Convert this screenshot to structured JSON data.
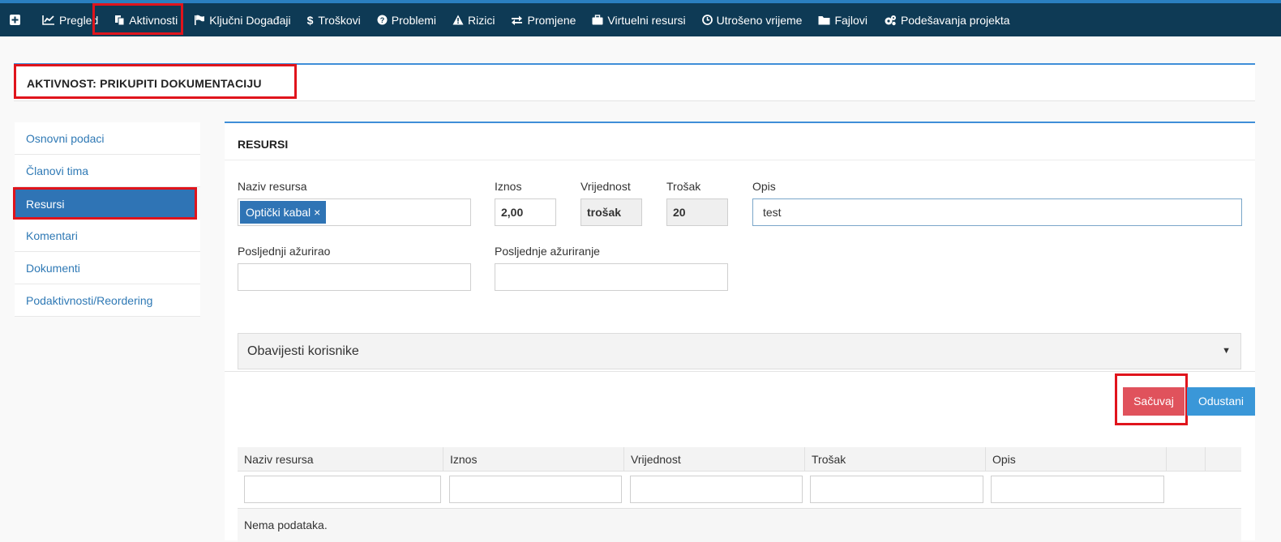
{
  "nav": {
    "items": [
      {
        "label": "Pregled",
        "icon": "chart-line-icon"
      },
      {
        "label": "Aktivnosti",
        "icon": "copy-icon"
      },
      {
        "label": "Ključni Događaji",
        "icon": "flag-icon"
      },
      {
        "label": "Troškovi",
        "icon": "dollar-icon"
      },
      {
        "label": "Problemi",
        "icon": "question-circle-icon"
      },
      {
        "label": "Rizici",
        "icon": "warning-icon"
      },
      {
        "label": "Promjene",
        "icon": "exchange-icon"
      },
      {
        "label": "Virtuelni resursi",
        "icon": "briefcase-icon"
      },
      {
        "label": "Utrošeno vrijeme",
        "icon": "clock-icon"
      },
      {
        "label": "Fajlovi",
        "icon": "folder-icon"
      },
      {
        "label": "Podešavanja projekta",
        "icon": "gears-icon"
      }
    ]
  },
  "page_title": "AKTIVNOST: PRIKUPITI DOKUMENTACIJU",
  "sidebar": {
    "items": [
      {
        "label": "Osnovni podaci"
      },
      {
        "label": "Članovi tima"
      },
      {
        "label": "Resursi"
      },
      {
        "label": "Komentari"
      },
      {
        "label": "Dokumenti"
      },
      {
        "label": "Podaktivnosti/Reordering"
      }
    ]
  },
  "form": {
    "title": "RESURSI",
    "naziv_label": "Naziv resursa",
    "naziv_tag": "Optički kabal",
    "tag_remove": "×",
    "iznos_label": "Iznos",
    "iznos_value": "2,00",
    "vrijednost_label": "Vrijednost",
    "vrijednost_value": "trošak",
    "trosak_label": "Trošak",
    "trosak_value": "20",
    "opis_label": "Opis",
    "opis_value": "test",
    "azurirao_label": "Posljednji ažurirao",
    "azurirao_value": "",
    "azuriranje_label": "Posljednje ažuriranje",
    "azuriranje_value": "",
    "accordion_label": "Obavijesti korisnike",
    "accordion_arrow": "▼",
    "save_label": "Sačuvaj",
    "cancel_label": "Odustani"
  },
  "table": {
    "columns": [
      "Naziv resursa",
      "Iznos",
      "Vrijednost",
      "Trošak",
      "Opis"
    ],
    "empty_text": "Nema podataka."
  }
}
